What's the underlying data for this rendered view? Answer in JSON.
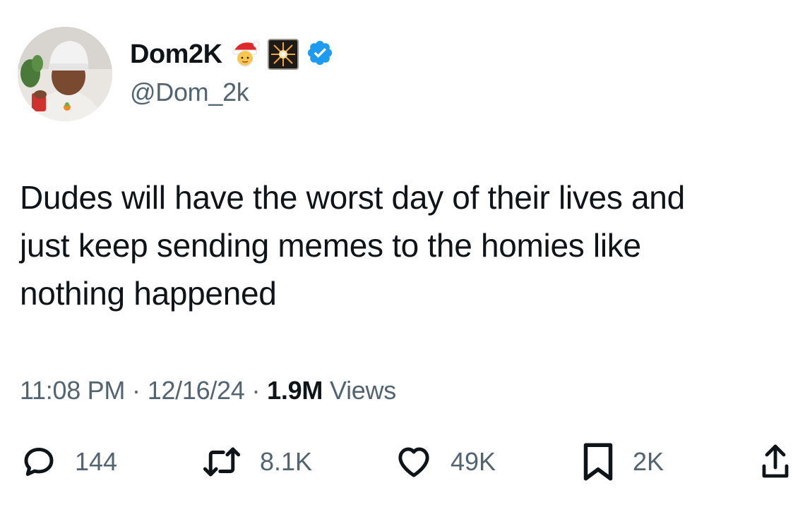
{
  "author": {
    "display_name": "Dom2K",
    "handle": "@Dom_2k",
    "verified": true,
    "name_emojis": [
      "santa-emoji",
      "fireworks-emoji"
    ]
  },
  "tweet": {
    "text": "Dudes will have the worst day of their lives and\njust keep sending memes to the homies like\nnothing happened"
  },
  "meta": {
    "time": "11:08 PM",
    "date": "12/16/24",
    "separator": "·",
    "views_count": "1.9M",
    "views_label": "Views"
  },
  "actions": {
    "replies": "144",
    "reposts": "8.1K",
    "likes": "49K",
    "bookmarks": "2K"
  },
  "colors": {
    "text": "#0f1419",
    "secondary": "#536471",
    "verified": "#1d9bf0",
    "background": "#ffffff"
  }
}
